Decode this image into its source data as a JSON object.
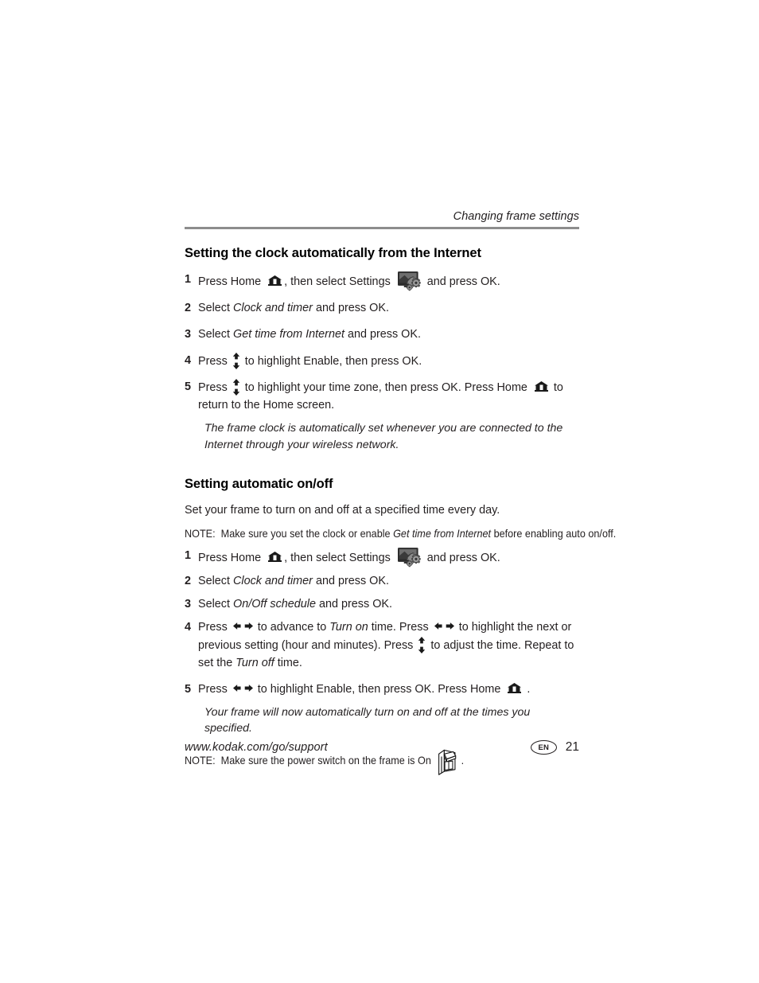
{
  "header": {
    "running_title": "Changing frame settings"
  },
  "sections": [
    {
      "title": "Setting the clock automatically from the Internet",
      "steps": [
        {
          "num": "1",
          "parts": [
            {
              "t": "text",
              "v": "Press Home "
            },
            {
              "t": "icon",
              "v": "home-icon"
            },
            {
              "t": "text",
              "v": ", then select Settings "
            },
            {
              "t": "icon",
              "v": "settings-icon"
            },
            {
              "t": "text",
              "v": " and press OK."
            }
          ]
        },
        {
          "num": "2",
          "parts": [
            {
              "t": "text",
              "v": "Select "
            },
            {
              "t": "italic",
              "v": "Clock and timer"
            },
            {
              "t": "text",
              "v": " and press OK."
            }
          ]
        },
        {
          "num": "3",
          "parts": [
            {
              "t": "text",
              "v": "Select "
            },
            {
              "t": "italic",
              "v": "Get time from Internet"
            },
            {
              "t": "text",
              "v": " and press OK."
            }
          ]
        },
        {
          "num": "4",
          "parts": [
            {
              "t": "text",
              "v": "Press "
            },
            {
              "t": "icon",
              "v": "up-down-arrows-icon"
            },
            {
              "t": "text",
              "v": " to highlight Enable, then press OK."
            }
          ]
        },
        {
          "num": "5",
          "parts": [
            {
              "t": "text",
              "v": "Press "
            },
            {
              "t": "icon",
              "v": "up-down-arrows-icon"
            },
            {
              "t": "text",
              "v": " to highlight your time zone, then press OK. Press Home "
            },
            {
              "t": "icon",
              "v": "home-icon"
            },
            {
              "t": "text",
              "v": " to return to the Home screen."
            }
          ]
        }
      ],
      "result_note": "The frame clock is automatically set whenever you are connected to the Internet through your wireless network."
    },
    {
      "title": "Setting automatic on/off",
      "intro": "Set your frame to turn on and off at a specified time every day.",
      "note": {
        "label": "NOTE:",
        "parts": [
          {
            "t": "text",
            "v": "Make sure you set the clock or enable "
          },
          {
            "t": "italic",
            "v": "Get time from Internet"
          },
          {
            "t": "text",
            "v": " before enabling auto on/off."
          }
        ]
      },
      "steps": [
        {
          "num": "1",
          "parts": [
            {
              "t": "text",
              "v": "Press Home "
            },
            {
              "t": "icon",
              "v": "home-icon"
            },
            {
              "t": "text",
              "v": ", then select Settings "
            },
            {
              "t": "icon",
              "v": "settings-icon"
            },
            {
              "t": "text",
              "v": " and press OK."
            }
          ]
        },
        {
          "num": "2",
          "parts": [
            {
              "t": "text",
              "v": "Select "
            },
            {
              "t": "italic",
              "v": "Clock and timer"
            },
            {
              "t": "text",
              "v": " and press OK."
            }
          ]
        },
        {
          "num": "3",
          "parts": [
            {
              "t": "text",
              "v": "Select "
            },
            {
              "t": "italic",
              "v": "On/Off schedule"
            },
            {
              "t": "text",
              "v": " and press OK."
            }
          ]
        },
        {
          "num": "4",
          "parts": [
            {
              "t": "text",
              "v": "Press "
            },
            {
              "t": "icon",
              "v": "left-right-arrows-icon"
            },
            {
              "t": "text",
              "v": " to advance to "
            },
            {
              "t": "italic",
              "v": "Turn on"
            },
            {
              "t": "text",
              "v": " time. Press "
            },
            {
              "t": "icon",
              "v": "left-right-arrows-icon"
            },
            {
              "t": "text",
              "v": " to highlight the next or previous setting (hour and minutes). Press "
            },
            {
              "t": "icon",
              "v": "up-down-arrows-icon"
            },
            {
              "t": "text",
              "v": " to adjust the time. Repeat to set the "
            },
            {
              "t": "italic",
              "v": "Turn off"
            },
            {
              "t": "text",
              "v": " time."
            }
          ]
        },
        {
          "num": "5",
          "parts": [
            {
              "t": "text",
              "v": "Press "
            },
            {
              "t": "icon",
              "v": "left-right-arrows-icon"
            },
            {
              "t": "text",
              "v": " to highlight Enable, then press OK. Press Home "
            },
            {
              "t": "icon",
              "v": "home-icon"
            },
            {
              "t": "text",
              "v": " ."
            }
          ]
        }
      ],
      "result_note": "Your frame will now automatically turn on and off at the times you specified.",
      "bottom_note": {
        "label": "NOTE:",
        "parts": [
          {
            "t": "text",
            "v": "Make sure the power switch on the frame is On "
          },
          {
            "t": "icon",
            "v": "power-switch-icon"
          },
          {
            "t": "text",
            "v": " ."
          }
        ]
      }
    }
  ],
  "footer": {
    "url": "www.kodak.com/go/support",
    "language": "EN",
    "page_number": "21"
  },
  "colors": {
    "text": "#231f20",
    "rule": "#8d8d8d",
    "icon_dark": "#1a1a1a",
    "icon_gray": "#9a9a9a"
  }
}
